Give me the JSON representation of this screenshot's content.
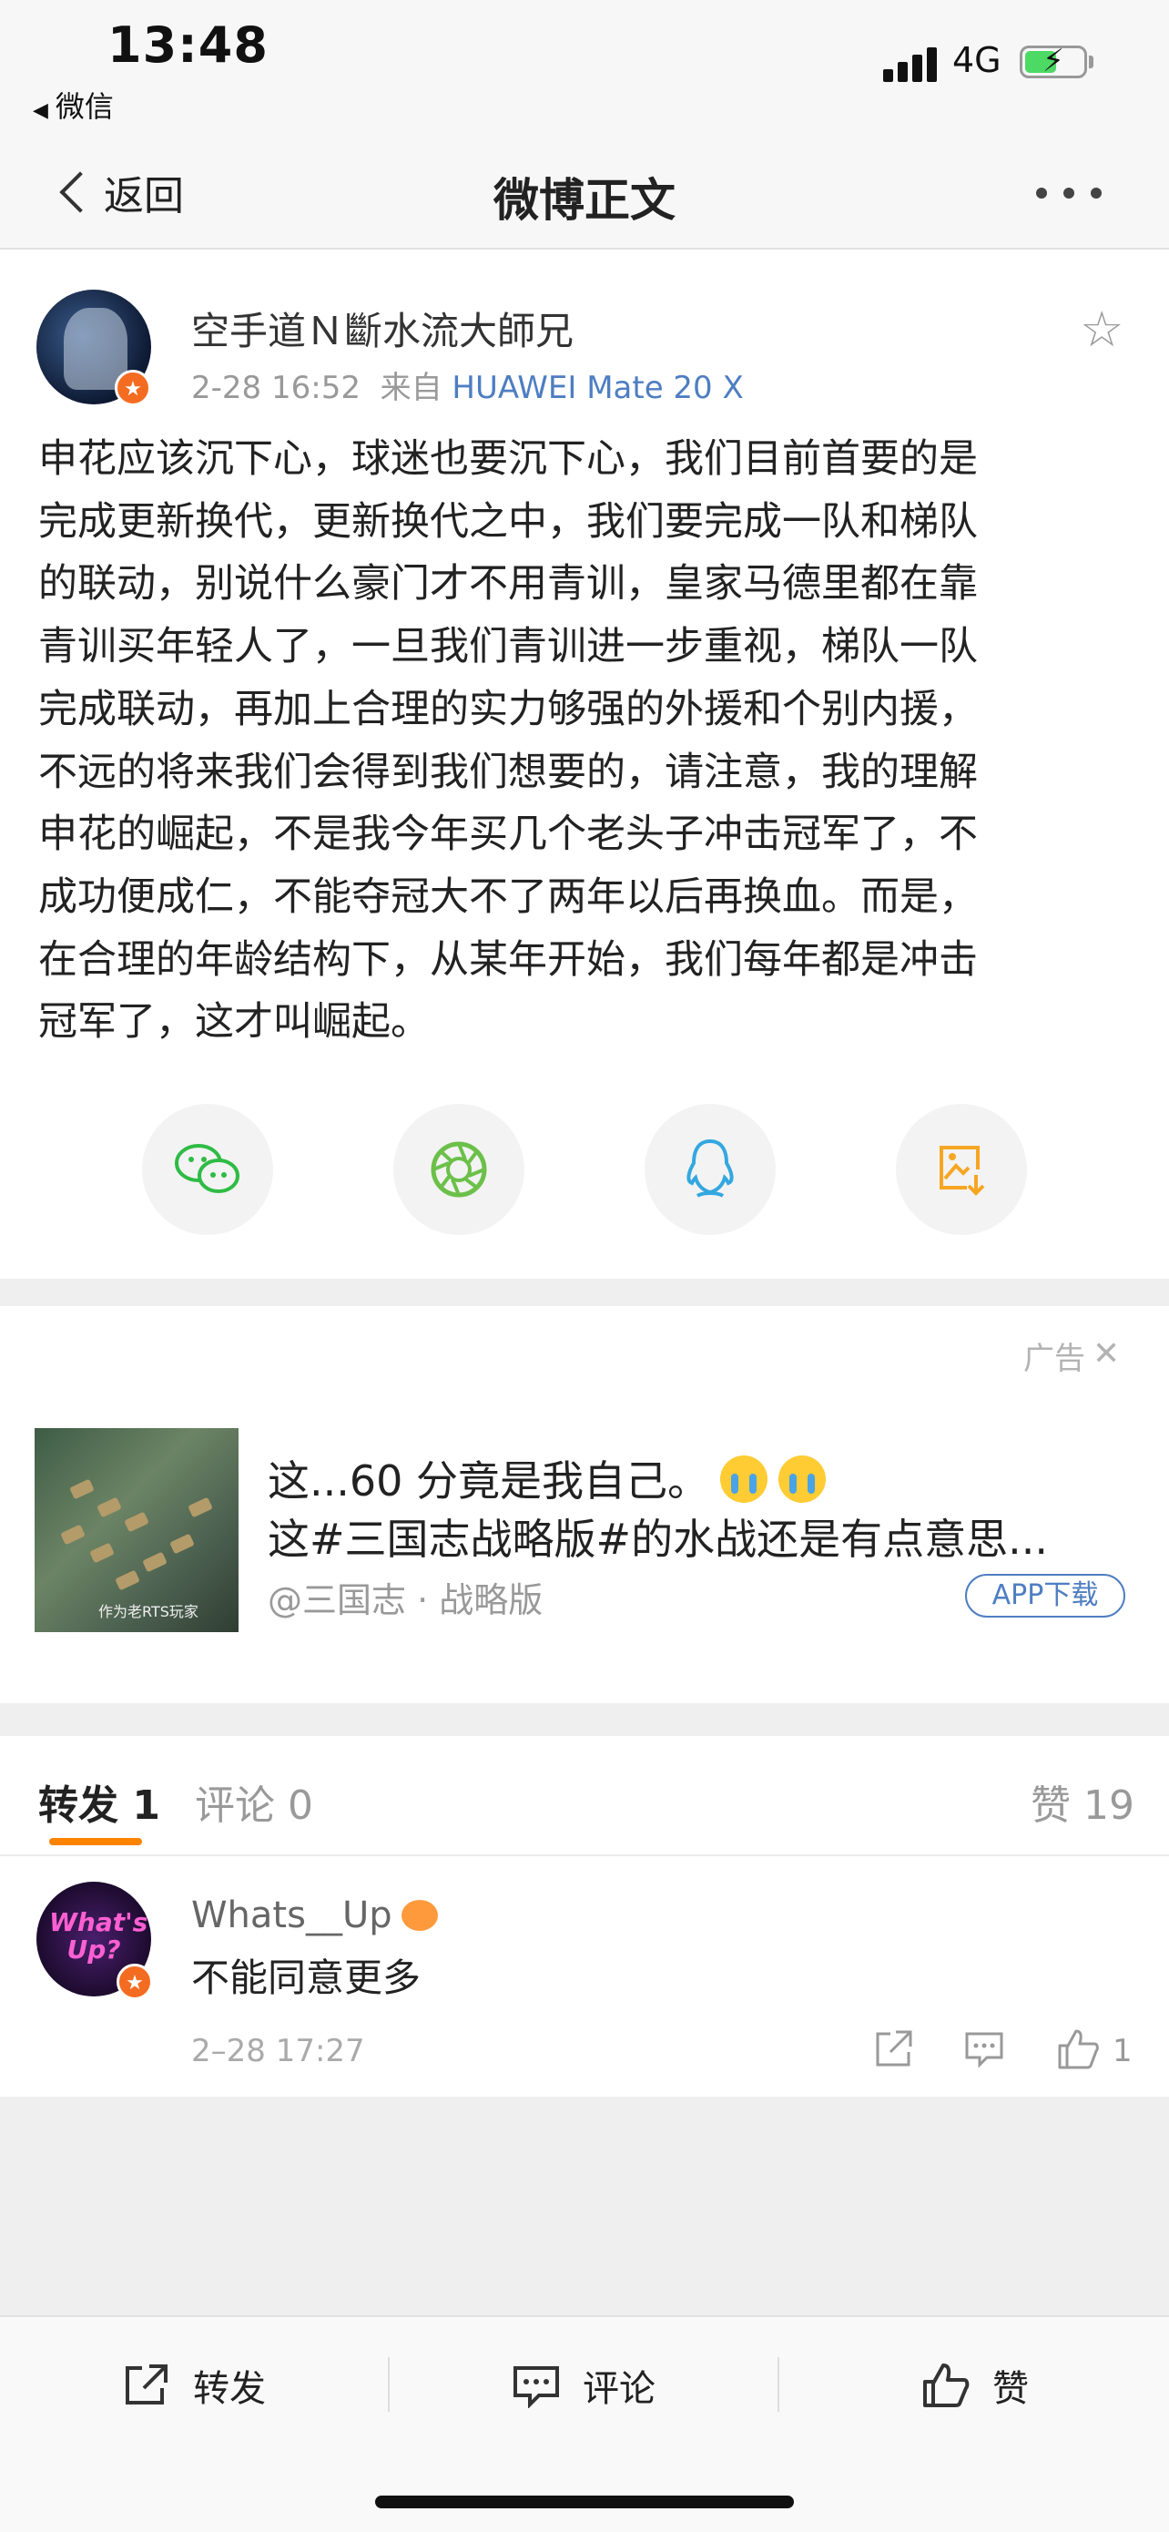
{
  "status_bar": {
    "time": "13:48",
    "back_app": "微信",
    "network": "4G",
    "battery_level": 0.55
  },
  "nav": {
    "back_label": "返回",
    "title": "微博正文"
  },
  "post": {
    "author": "空手道Ｎ斷水流大師兄",
    "time": "2-28 16:52",
    "source_prefix": "来自",
    "source": "HUAWEI Mate 20 X",
    "body_lines": [
      "申花应该沉下心，球迷也要沉下心，我们目前首要的是",
      "完成更新换代，更新换代之中，我们要完成一队和梯队",
      "的联动，别说什么豪门才不用青训，皇家马德里都在靠",
      "青训买年轻人了，一旦我们青训进一步重视，梯队一队",
      "完成联动，再加上合理的实力够强的外援和个别内援，",
      "不远的将来我们会得到我们想要的，请注意，我的理解",
      "申花的崛起，不是我今年买几个老头子冲击冠军了，不",
      "成功便成仁，不能夺冠大不了两年以后再换血。而是，",
      "在合理的年龄结构下，从某年开始，我们每年都是冲击",
      "冠军了，这才叫崛起。"
    ]
  },
  "share": {
    "icons": [
      "wechat-icon",
      "moments-icon",
      "qq-icon",
      "save-image-icon"
    ],
    "colors": {
      "wechat": "#2fbb45",
      "moments": "#6cc04a",
      "qq": "#34a7e0",
      "save": "#f6a623"
    }
  },
  "ad": {
    "label": "广告",
    "line1": "这...60 分竟是我自己。",
    "line2": "这#三国志战略版#的水战还是有点意思...",
    "account": "@三国志 · 战略版",
    "cta": "APP下载",
    "thumb_watermark": "作为老RTS玩家"
  },
  "tabs": {
    "forward": "转发 1",
    "comment": "评论 0",
    "like": "赞 19"
  },
  "comment": {
    "avatar_text": "What's Up?",
    "name": "Whats__Up",
    "text": "不能同意更多",
    "time": "2–28 17:27",
    "like_count": "1"
  },
  "bottom_bar": {
    "forward": "转发",
    "comment": "评论",
    "like": "赞"
  },
  "colors": {
    "accent_orange": "#ff8200",
    "link_blue": "#4e7ec2",
    "verified_badge": "#f36c21"
  }
}
